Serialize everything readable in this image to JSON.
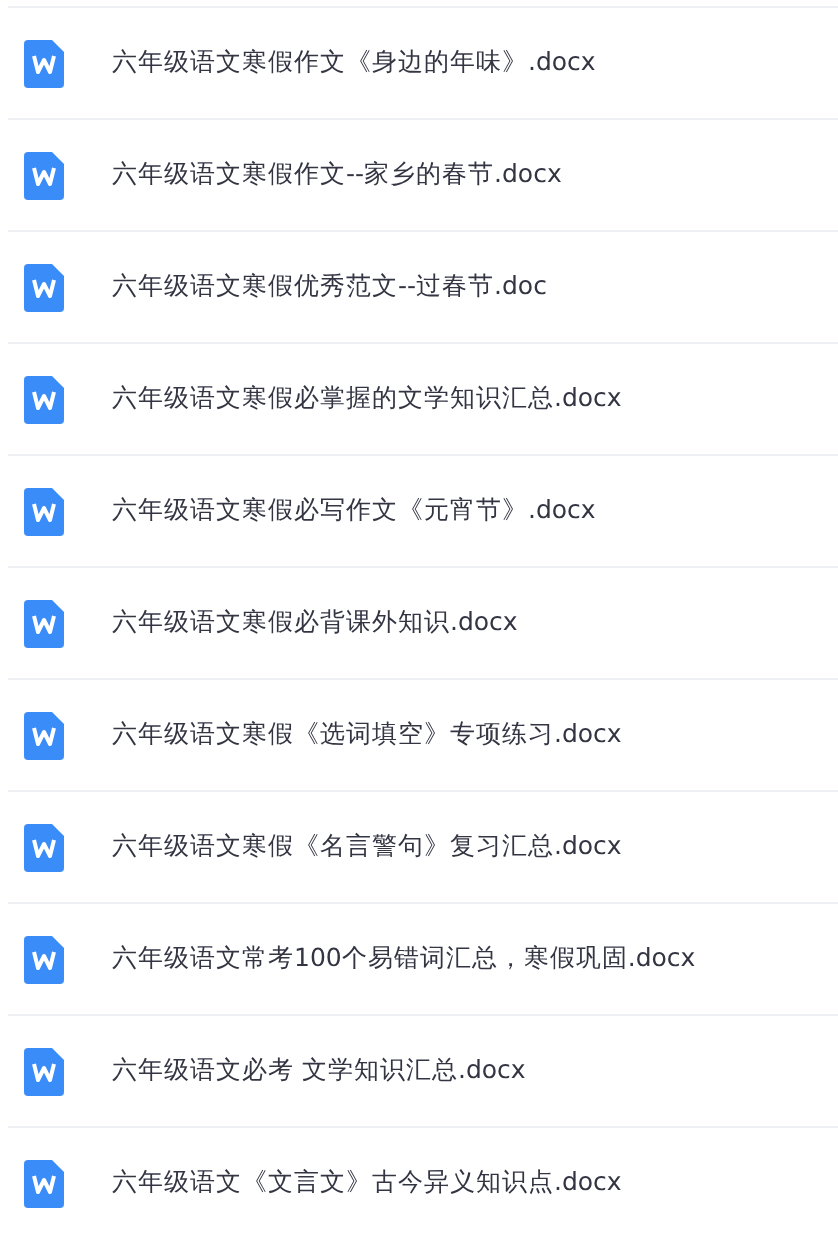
{
  "files": [
    {
      "name": "六年级语文寒假作文《身边的年味》.docx"
    },
    {
      "name": "六年级语文寒假作文--家乡的春节.docx"
    },
    {
      "name": "六年级语文寒假优秀范文--过春节.doc"
    },
    {
      "name": "六年级语文寒假必掌握的文学知识汇总.docx"
    },
    {
      "name": "六年级语文寒假必写作文《元宵节》.docx"
    },
    {
      "name": "六年级语文寒假必背课外知识.docx"
    },
    {
      "name": "六年级语文寒假《选词填空》专项练习.docx"
    },
    {
      "name": "六年级语文寒假《名言警句》复习汇总.docx"
    },
    {
      "name": "六年级语文常考100个易错词汇总，寒假巩固.docx"
    },
    {
      "name": "六年级语文必考 文学知识汇总.docx"
    },
    {
      "name": "六年级语文《文言文》古今异义知识点.docx"
    }
  ]
}
